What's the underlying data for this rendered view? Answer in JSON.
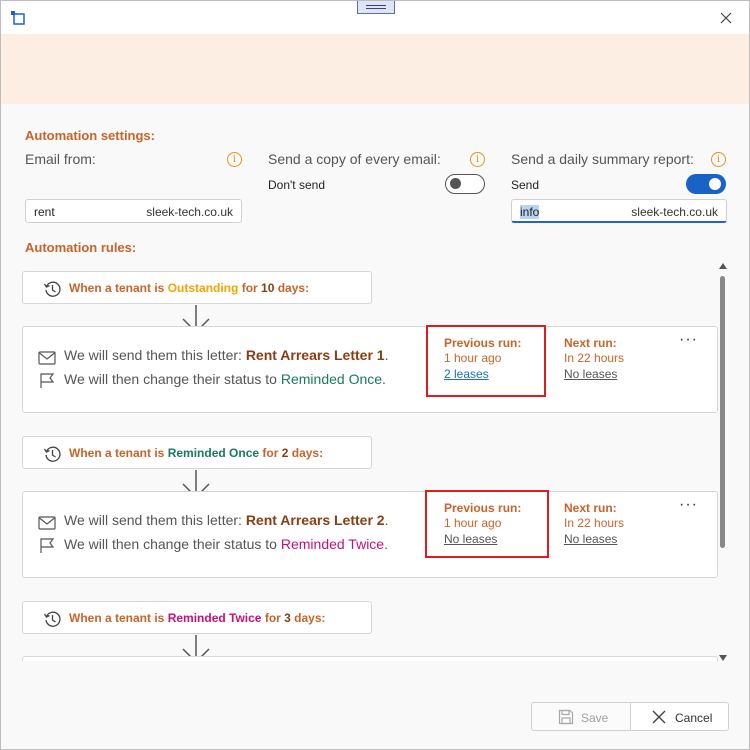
{
  "window": {
    "title": ""
  },
  "settings": {
    "section_title": "Automation settings:",
    "email_from": {
      "label": "Email from:",
      "value": "rent",
      "domain": "sleek-tech.co.uk"
    },
    "copy": {
      "label": "Send a copy of every email:",
      "state_text": "Don't send",
      "enabled": false
    },
    "summary": {
      "label": "Send a daily summary report:",
      "state_text": "Send",
      "enabled": true,
      "value": "info",
      "domain": "sleek-tech.co.uk"
    }
  },
  "rules": {
    "section_title": "Automation rules:",
    "items": [
      {
        "trigger": {
          "prefix": "When a tenant is ",
          "status": "Outstanding",
          "mid": " for ",
          "days": "10",
          "suffix": " days:"
        },
        "letter_prefix": "We will send them this letter: ",
        "letter": "Rent Arrears Letter 1",
        "letter_suffix": ".",
        "status_prefix": "We will then change their status to ",
        "new_status": "Reminded Once",
        "status_suffix": ".",
        "previous": {
          "label": "Previous run:",
          "time": "1 hour ago",
          "link": "2 leases"
        },
        "next": {
          "label": "Next run:",
          "time": "In 22 hours",
          "link": "No leases"
        },
        "more": "···"
      },
      {
        "trigger": {
          "prefix": "When a tenant is ",
          "status": "Reminded Once",
          "mid": " for ",
          "days": "2",
          "suffix": " days:"
        },
        "letter_prefix": "We will send them this letter: ",
        "letter": "Rent Arrears Letter 2",
        "letter_suffix": ".",
        "status_prefix": "We will then change their status to ",
        "new_status": "Reminded Twice",
        "status_suffix": ".",
        "previous": {
          "label": "Previous run:",
          "time": "1 hour ago",
          "link": "No leases"
        },
        "next": {
          "label": "Next run:",
          "time": "In 22 hours",
          "link": "No leases"
        },
        "more": "···"
      },
      {
        "trigger": {
          "prefix": "When a tenant is ",
          "status": "Reminded Twice",
          "mid": " for ",
          "days": "3",
          "suffix": " days:"
        }
      }
    ]
  },
  "footer": {
    "save_label": "Save",
    "cancel_label": "Cancel"
  },
  "colors": {
    "accent": "#c8642a",
    "toggle_on": "#1a63c6",
    "highlight": "#e01b1b",
    "banner": "#fdeee4"
  },
  "icons": [
    "app-icon",
    "close-icon",
    "info-icon",
    "clock-history-icon",
    "arrow-down-icon",
    "mail-icon",
    "flag-icon",
    "more-icon",
    "save-icon",
    "cancel-icon"
  ]
}
